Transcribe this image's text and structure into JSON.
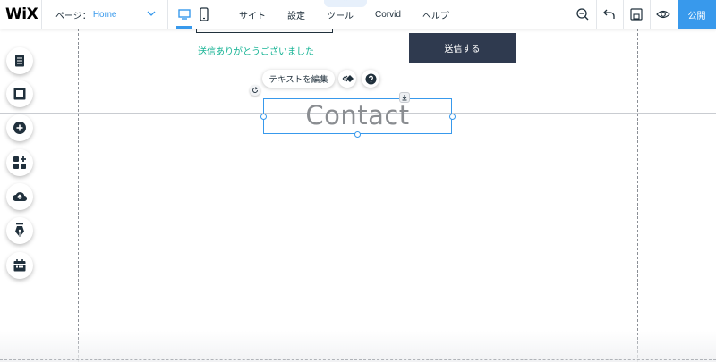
{
  "app": {
    "logo": "WiX"
  },
  "page_selector": {
    "label": "ページ：",
    "value": "Home"
  },
  "menu": [
    "サイト",
    "設定",
    "ツール",
    "Corvid",
    "ヘルプ"
  ],
  "top_tab": "⌃",
  "publish_label": "公開",
  "stage": {
    "success_message": "送信ありがとうございました",
    "submit_label": "送信する",
    "contact_title": "Contact"
  },
  "element_toolbar": {
    "edit_text_label": "テキストを編集"
  },
  "colors": {
    "accent": "#3899ec",
    "success": "#16b394",
    "dark_button": "#2f3a4f"
  },
  "icons": {
    "left_toolbar": [
      "menus-pages-icon",
      "background-icon",
      "add-icon",
      "app-market-icon",
      "upload-icon",
      "blog-pen-icon",
      "bookings-calendar-icon"
    ],
    "top_tools": [
      "zoom-out-icon",
      "undo-icon",
      "save-icon",
      "preview-eye-icon"
    ]
  }
}
